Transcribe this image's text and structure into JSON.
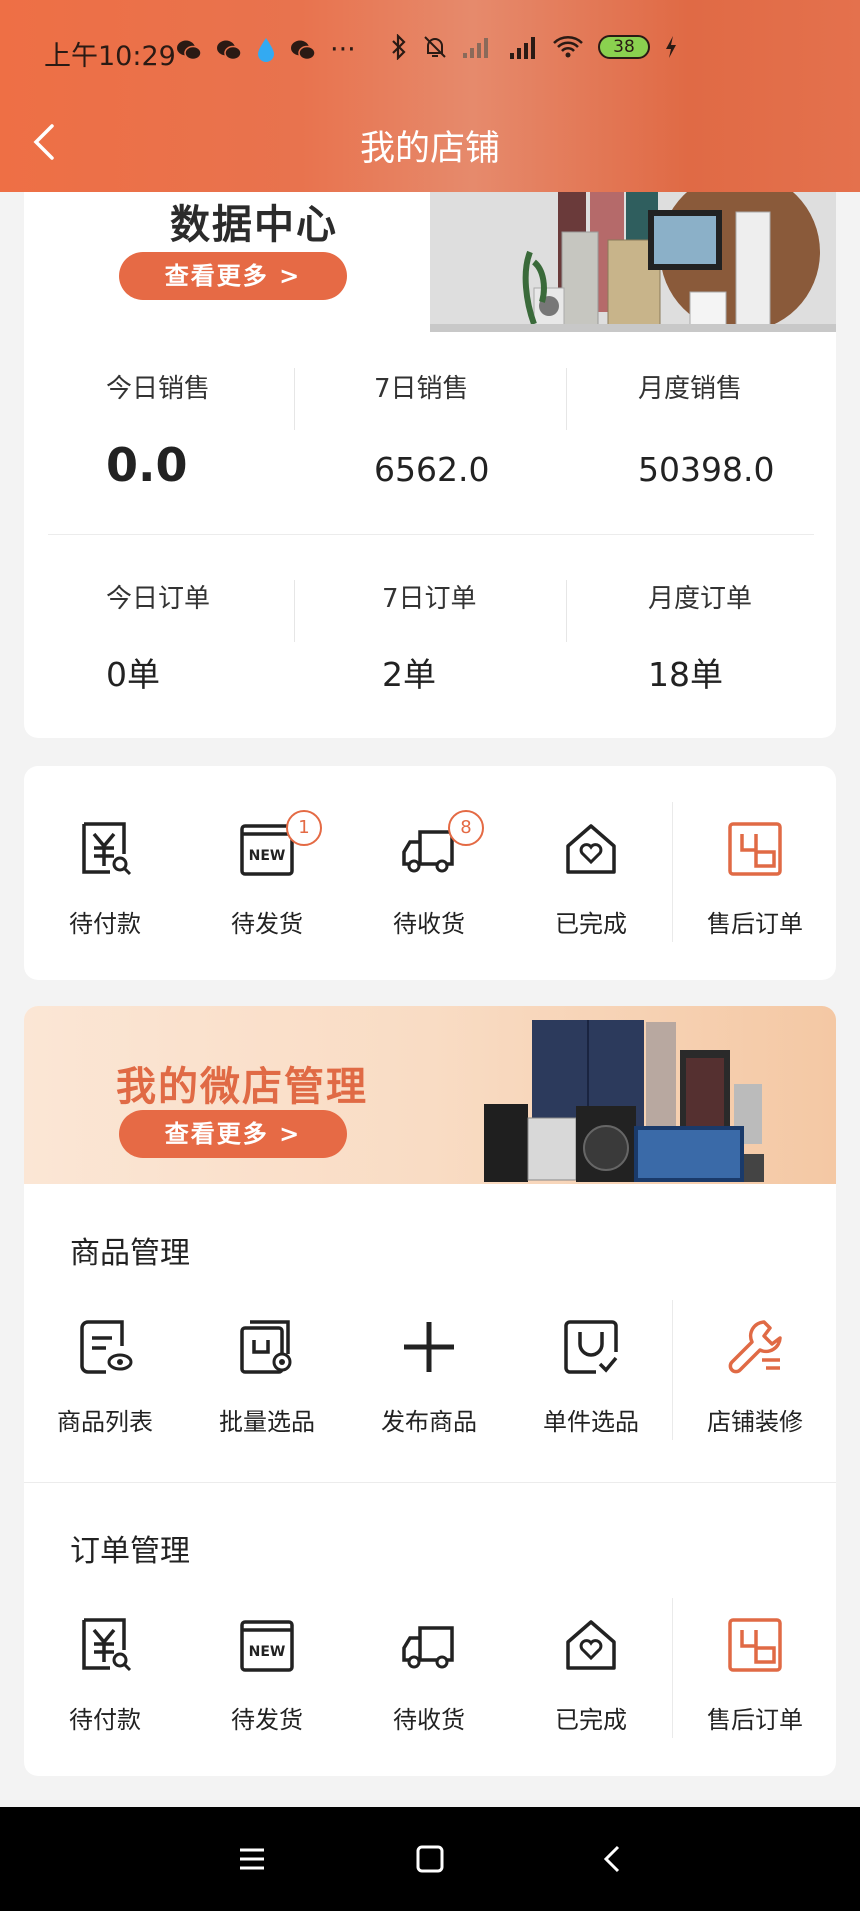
{
  "status_bar": {
    "time": "上午10:29",
    "battery": "38",
    "more": "···"
  },
  "header": {
    "title": "我的店铺"
  },
  "data_center": {
    "title": "数据中心",
    "more_button": "查看更多 >"
  },
  "stats": {
    "sales": [
      {
        "label": "今日销售",
        "value": "0.0"
      },
      {
        "label": "7日销售",
        "value": "6562.0"
      },
      {
        "label": "月度销售",
        "value": "50398.0"
      }
    ],
    "orders": [
      {
        "label": "今日订单",
        "value": "0单"
      },
      {
        "label": "7日订单",
        "value": "2单"
      },
      {
        "label": "月度订单",
        "value": "18单"
      }
    ]
  },
  "order_status": {
    "items": [
      {
        "label": "待付款",
        "icon": "yuan-search-icon"
      },
      {
        "label": "待发货",
        "icon": "new-box-icon",
        "badge": "1"
      },
      {
        "label": "待收货",
        "icon": "truck-icon",
        "badge": "8"
      },
      {
        "label": "已完成",
        "icon": "house-heart-icon"
      },
      {
        "label": "售后订单",
        "icon": "after-sale-icon"
      }
    ]
  },
  "management": {
    "banner_title": "我的微店管理",
    "banner_button": "查看更多 >",
    "product_section": {
      "title": "商品管理",
      "items": [
        {
          "label": "商品列表",
          "icon": "product-list-icon"
        },
        {
          "label": "批量选品",
          "icon": "batch-select-icon"
        },
        {
          "label": "发布商品",
          "icon": "plus-icon"
        },
        {
          "label": "单件选品",
          "icon": "single-select-icon"
        },
        {
          "label": "店铺装修",
          "icon": "wrench-icon"
        }
      ]
    },
    "order_section": {
      "title": "订单管理",
      "items": [
        {
          "label": "待付款",
          "icon": "yuan-search-icon"
        },
        {
          "label": "待发货",
          "icon": "new-box-icon"
        },
        {
          "label": "待收货",
          "icon": "truck-icon"
        },
        {
          "label": "已完成",
          "icon": "house-heart-icon"
        },
        {
          "label": "售后订单",
          "icon": "after-sale-icon"
        }
      ]
    }
  },
  "colors": {
    "accent": "#e66a45",
    "header_start": "#ee6f45"
  }
}
